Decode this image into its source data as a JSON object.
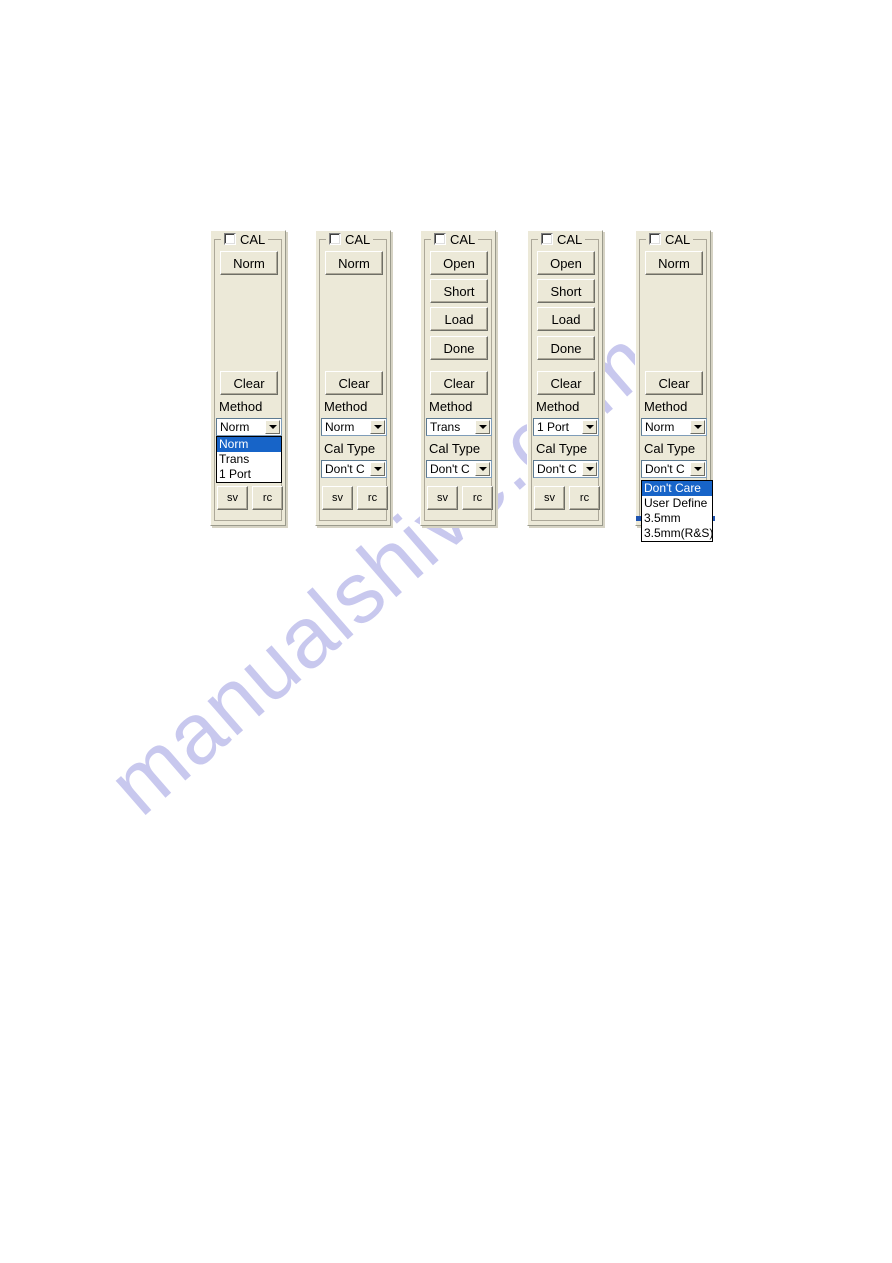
{
  "watermark": {
    "text": "manualshive.com",
    "color": "#c8c8ee"
  },
  "theme": {
    "panel_face": "#ece9d8",
    "selection_blue": "#1764c8",
    "combo_border": "#7f9db9",
    "text": "#000000"
  },
  "panels": [
    {
      "id": "panel-norm-method-open",
      "group": {
        "label": "CAL",
        "checkbox_checked": false
      },
      "action_buttons": [
        "Norm"
      ],
      "clear_button": "Clear",
      "method": {
        "label": "Method",
        "value": "Norm",
        "open": true,
        "options": [
          "Norm",
          "Trans",
          "1 Port"
        ],
        "selected": "Norm"
      },
      "cal_type": null,
      "footer_buttons": [
        "sv",
        "rc"
      ]
    },
    {
      "id": "panel-norm",
      "group": {
        "label": "CAL",
        "checkbox_checked": false
      },
      "action_buttons": [
        "Norm"
      ],
      "clear_button": "Clear",
      "method": {
        "label": "Method",
        "value": "Norm",
        "open": false
      },
      "cal_type": {
        "label": "Cal Type",
        "value": "Don't  C",
        "open": false
      },
      "footer_buttons": [
        "sv",
        "rc"
      ]
    },
    {
      "id": "panel-trans",
      "group": {
        "label": "CAL",
        "checkbox_checked": false
      },
      "action_buttons": [
        "Open",
        "Short",
        "Load",
        "Done"
      ],
      "clear_button": "Clear",
      "method": {
        "label": "Method",
        "value": "Trans",
        "open": false
      },
      "cal_type": {
        "label": "Cal Type",
        "value": "Don't  C",
        "open": false
      },
      "footer_buttons": [
        "sv",
        "rc"
      ]
    },
    {
      "id": "panel-1port",
      "group": {
        "label": "CAL",
        "checkbox_checked": false
      },
      "action_buttons": [
        "Open",
        "Short",
        "Load",
        "Done"
      ],
      "clear_button": "Clear",
      "method": {
        "label": "Method",
        "value": "1 Port",
        "open": false
      },
      "cal_type": {
        "label": "Cal Type",
        "value": "Don't  C",
        "open": false
      },
      "footer_buttons": [
        "sv",
        "rc"
      ]
    },
    {
      "id": "panel-norm-caltype-open",
      "group": {
        "label": "CAL",
        "checkbox_checked": false
      },
      "action_buttons": [
        "Norm"
      ],
      "clear_button": "Clear",
      "method": {
        "label": "Method",
        "value": "Norm",
        "open": false
      },
      "cal_type": {
        "label": "Cal Type",
        "value": "Don't  C",
        "open": true,
        "options": [
          "Don't  Care",
          "User Define",
          "3.5mm",
          "3.5mm(R&S)"
        ],
        "selected": "Don't  Care"
      },
      "footer_buttons": [
        "sv",
        "rc"
      ]
    }
  ]
}
